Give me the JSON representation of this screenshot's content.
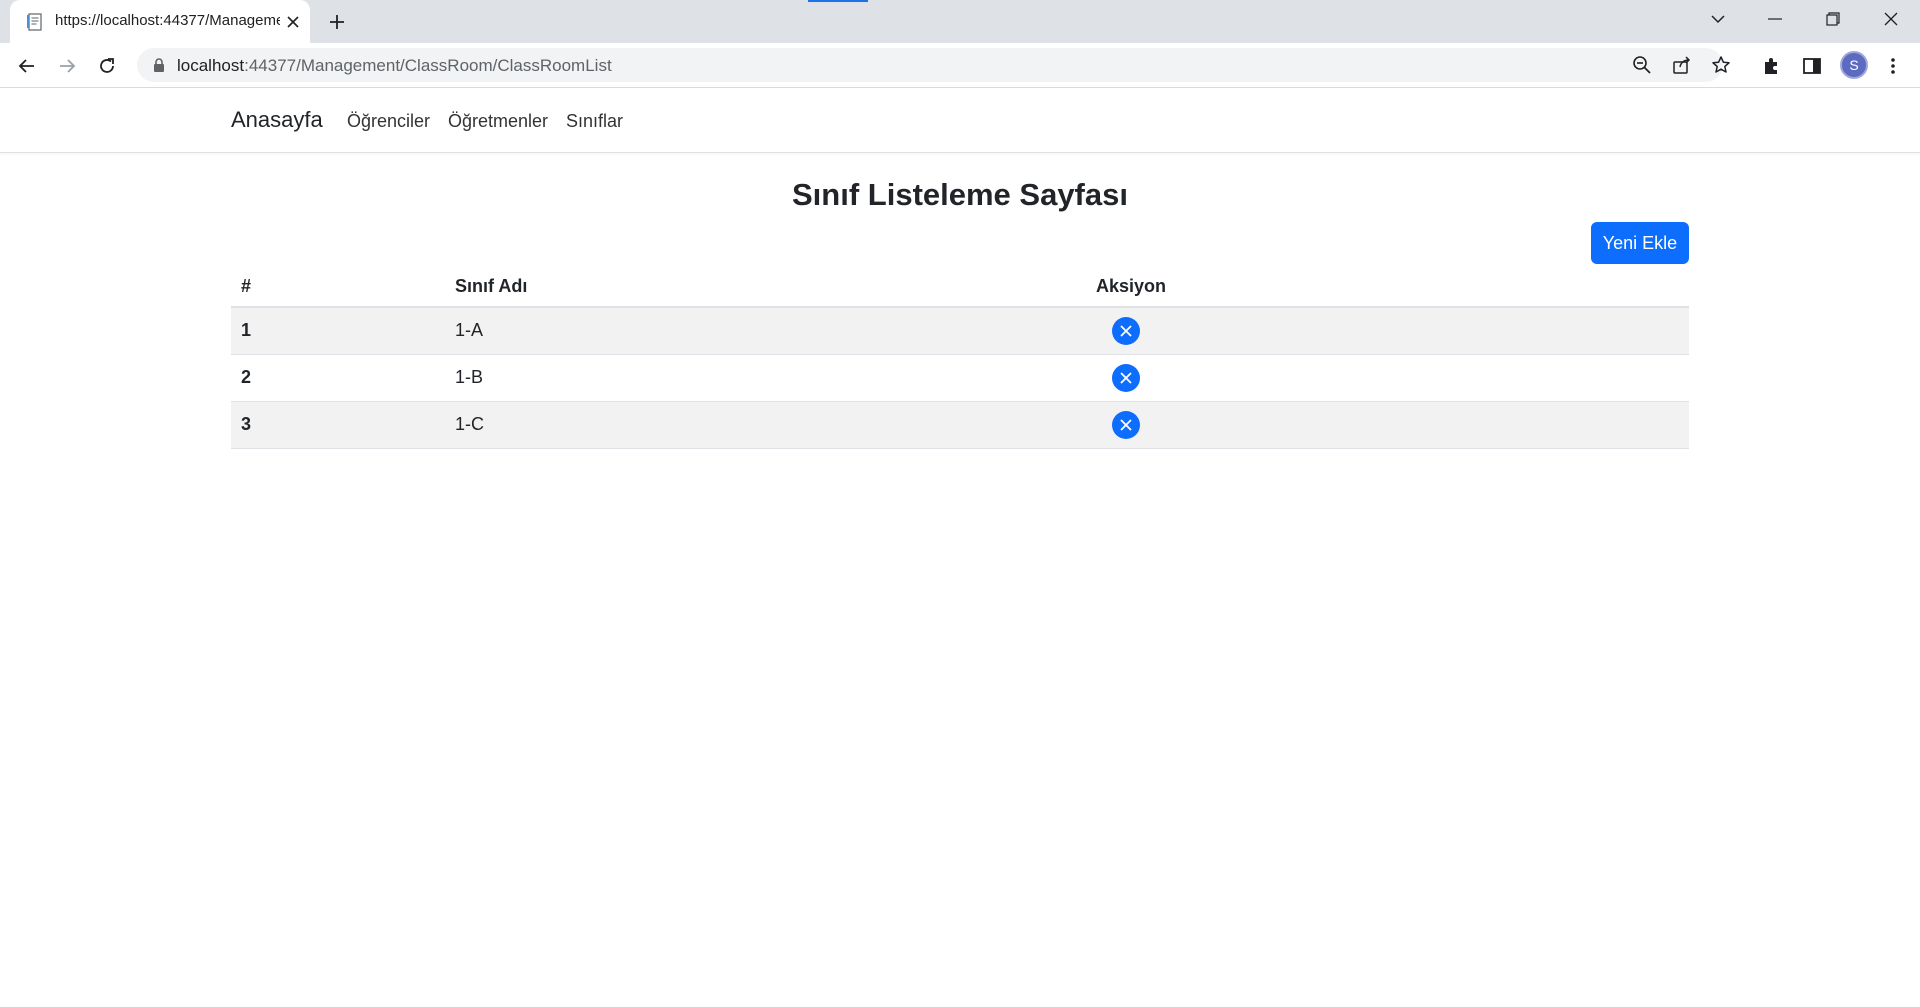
{
  "browser": {
    "tab_title": "https://localhost:44377/Management/ClassRoom/ClassRoomList",
    "url_host": "localhost",
    "url_rest": ":44377/Management/ClassRoom/ClassRoomList",
    "profile_initial": "S"
  },
  "nav": {
    "brand": "Anasayfa",
    "links": [
      "Öğrenciler",
      "Öğretmenler",
      "Sınıflar"
    ]
  },
  "page": {
    "title": "Sınıf Listeleme Sayfası",
    "new_button": "Yeni Ekle"
  },
  "table": {
    "headers": [
      "#",
      "Sınıf Adı",
      "Aksiyon"
    ],
    "rows": [
      {
        "num": "1",
        "name": "1-A"
      },
      {
        "num": "2",
        "name": "1-B"
      },
      {
        "num": "3",
        "name": "1-C"
      }
    ]
  },
  "colors": {
    "primary": "#0d6efd",
    "stripe": "#f2f2f2",
    "chrome_strip": "#dee1e6"
  }
}
